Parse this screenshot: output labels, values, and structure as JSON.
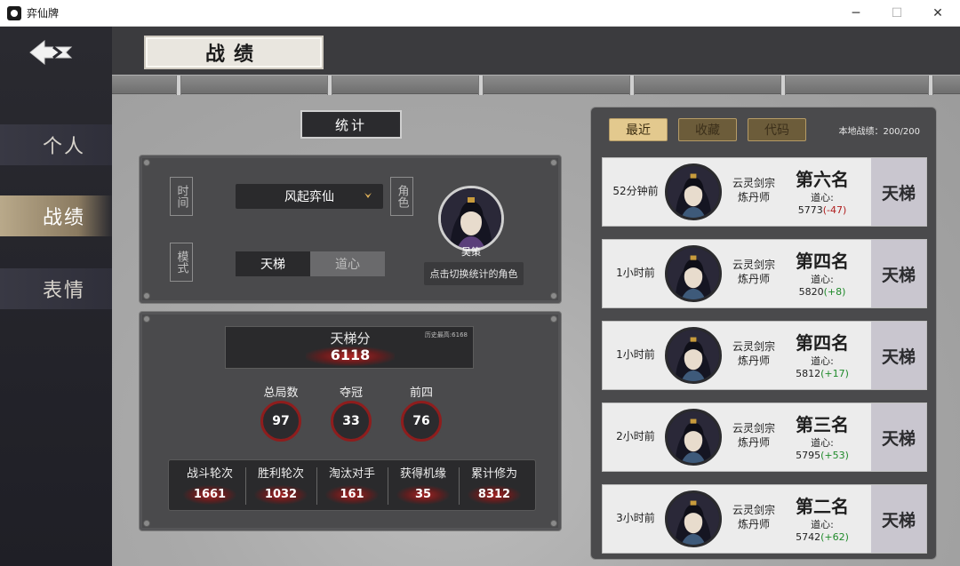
{
  "window": {
    "title": "弈仙牌",
    "minimize": "─",
    "maximize": "☐",
    "close": "✕"
  },
  "sidebar": {
    "items": [
      {
        "label": "个人"
      },
      {
        "label": "战绩"
      },
      {
        "label": "表情"
      }
    ],
    "active_index": 1
  },
  "page": {
    "title": "战绩",
    "section": "统计"
  },
  "filters": {
    "time_label": "时间",
    "time_value": "风起弈仙",
    "mode_label": "模式",
    "modes": [
      "天梯",
      "道心"
    ],
    "selected_mode": "天梯",
    "role_label": "角色",
    "role_name": "吴策",
    "switch_role": "点击切换统计的角色"
  },
  "ladder": {
    "title": "天梯分",
    "value": "6118",
    "history_high": "历史最高:6168"
  },
  "summary": [
    {
      "label": "总局数",
      "value": "97"
    },
    {
      "label": "夺冠",
      "value": "33"
    },
    {
      "label": "前四",
      "value": "76"
    }
  ],
  "stats": [
    {
      "label": "战斗轮次",
      "value": "1661"
    },
    {
      "label": "胜利轮次",
      "value": "1032"
    },
    {
      "label": "淘汰对手",
      "value": "161"
    },
    {
      "label": "获得机缘",
      "value": "35"
    },
    {
      "label": "累计修为",
      "value": "8312"
    }
  ],
  "history": {
    "tabs": [
      "最近",
      "收藏",
      "代码"
    ],
    "active_tab": "最近",
    "local_records": "本地战绩：200/200",
    "records": [
      {
        "time": "52分钟前",
        "sect": "云灵剑宗",
        "role": "炼丹师",
        "rank": "第六名",
        "dao_label": "道心:",
        "dao": "5773",
        "delta": "(-47)",
        "mode": "天梯"
      },
      {
        "time": "1小时前",
        "sect": "云灵剑宗",
        "role": "炼丹师",
        "rank": "第四名",
        "dao_label": "道心:",
        "dao": "5820",
        "delta": "(+8)",
        "mode": "天梯"
      },
      {
        "time": "1小时前",
        "sect": "云灵剑宗",
        "role": "炼丹师",
        "rank": "第四名",
        "dao_label": "道心:",
        "dao": "5812",
        "delta": "(+17)",
        "mode": "天梯"
      },
      {
        "time": "2小时前",
        "sect": "云灵剑宗",
        "role": "炼丹师",
        "rank": "第三名",
        "dao_label": "道心:",
        "dao": "5795",
        "delta": "(+53)",
        "mode": "天梯"
      },
      {
        "time": "3小时前",
        "sect": "云灵剑宗",
        "role": "炼丹师",
        "rank": "第二名",
        "dao_label": "道心:",
        "dao": "5742",
        "delta": "(+62)",
        "mode": "天梯"
      }
    ]
  },
  "icons": {
    "back": "back-arrow-icon",
    "dropdown": "chevron-down-icon",
    "app": "app-icon"
  },
  "colors": {
    "accent_gold": "#e3c98e",
    "delta_negative": "#b01d1d",
    "delta_positive": "#1f8a2a",
    "stat_ring": "#8e1d1d"
  }
}
